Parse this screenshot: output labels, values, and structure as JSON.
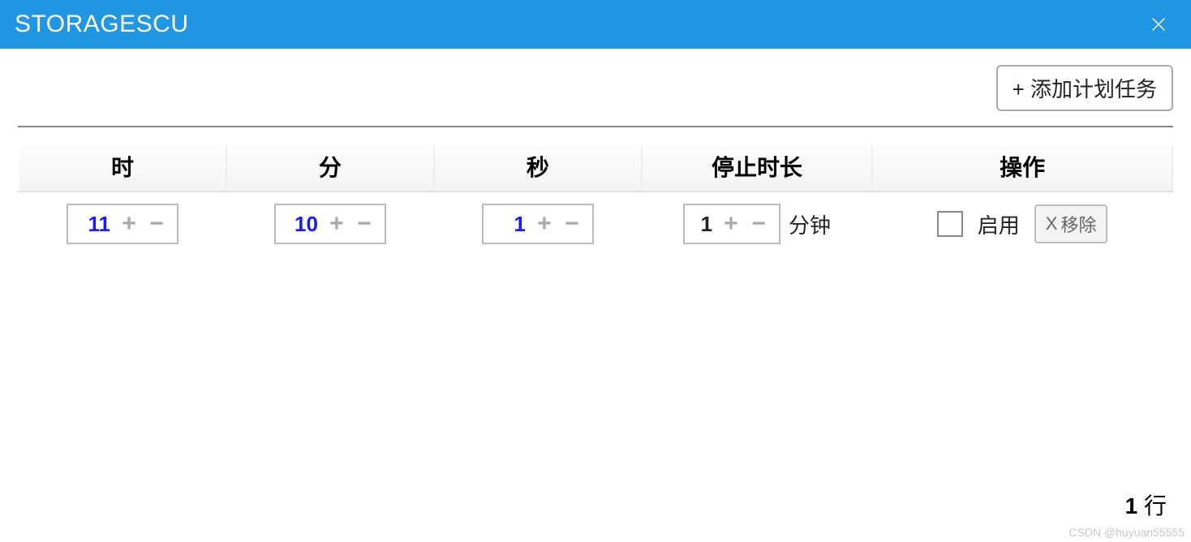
{
  "window": {
    "title": "STORAGESCU"
  },
  "toolbar": {
    "add_label": "+ 添加计划任务"
  },
  "table": {
    "headers": {
      "hour": "时",
      "minute": "分",
      "second": "秒",
      "stop_duration": "停止时长",
      "actions": "操作"
    },
    "rows": [
      {
        "hour": "11",
        "minute": "10",
        "second": "1",
        "stop_value": "1",
        "stop_unit": "分钟",
        "enabled": false,
        "enable_label": "启用",
        "remove_label": "移除"
      }
    ]
  },
  "footer": {
    "count": "1",
    "unit": "行"
  },
  "watermark": "CSDN @huyuan55555"
}
